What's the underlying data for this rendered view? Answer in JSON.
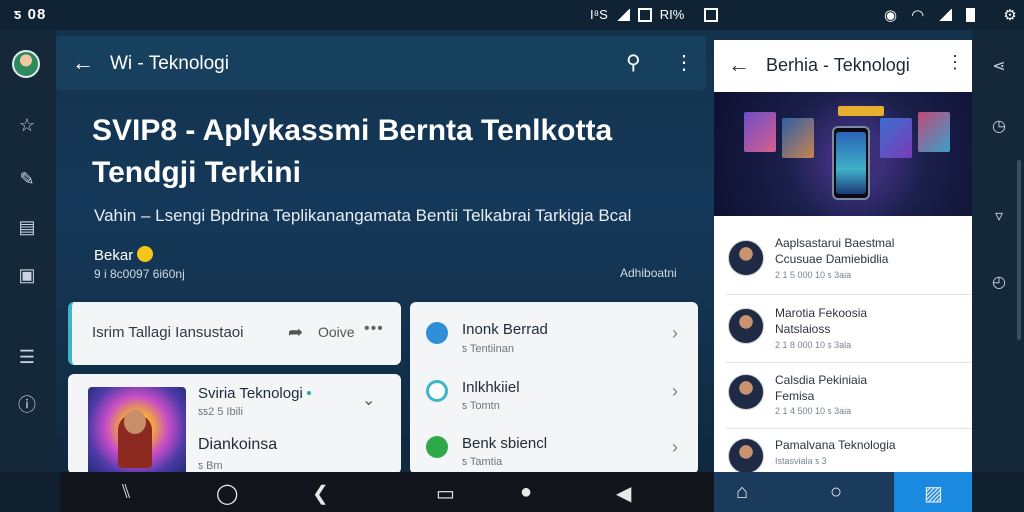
{
  "status_bar": {
    "time": "ƽ 08",
    "center_text": "RI%",
    "center_icon_label": "I⁸S"
  },
  "main": {
    "title": "Wi - Teknologi",
    "headline": "SVIP8 - Aplykassmi Bernta Tenlkotta Tendgji Terkini",
    "subline": "Vahin – Lsengi Bpdrina Teplikanangamata Bentii Telkabrai Tarkigja Bcal",
    "author": "Bekar",
    "meta_left": "9 i 8c0097  6i60nj",
    "meta_right": "Adhiboatni",
    "action_card": {
      "label": "Isrim Tallagi  Iansustaoi",
      "action_text": "Ooive"
    },
    "feature_card": {
      "title": "Sviria Teknologi",
      "subtitle": "ƽƽ2 5 Ibili",
      "name": "Diankoinsa",
      "small": "ƽ Bm"
    },
    "list_card": [
      {
        "title": "Inonk Berrad",
        "sub": "ƽ Tentiinan",
        "icon_color": "#2f8fd8"
      },
      {
        "title": "Inlkhkiiel",
        "sub": "ƽ Tomtn",
        "icon_color": "#3fb7c9"
      },
      {
        "title": "Benk sbiencl",
        "sub": "ƽ Tamtia",
        "icon_color": "#2fa84a"
      }
    ]
  },
  "panel": {
    "title": "Berhia - Teknologi",
    "items": [
      {
        "line1": "Aaplsastarui Baestmal",
        "line2": "Ccusuae Damiebidlia",
        "meta": "2 1 5 000 10  ƽ 3aia"
      },
      {
        "line1": "Marotia Fekoosia",
        "line2": "Natslaioss",
        "meta": "2 1 8 000 10  ƽ 3ala"
      },
      {
        "line1": "Calsdia Pekiniaia",
        "line2": "Femisa",
        "meta": "2 1 4 500 10  ƽ 3aia"
      },
      {
        "line1": "Pamalvana Teknologia",
        "line2": "",
        "meta": "Istasviala  ƽ 3"
      }
    ]
  },
  "colors": {
    "accent": "#1a8ae0",
    "card_bg": "#f3f5f7",
    "app_bg": "#15395a"
  }
}
